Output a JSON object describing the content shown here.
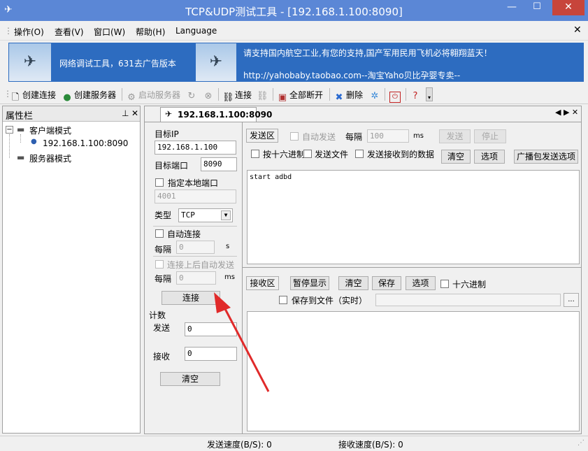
{
  "window": {
    "title": "TCP&UDP测试工具 - [192.168.1.100:8090]",
    "minimize": "—",
    "maximize": "☐",
    "close": "✕",
    "app_icon": "tool-icon"
  },
  "menu": {
    "items": [
      "操作(O)",
      "查看(V)",
      "窗口(W)",
      "帮助(H)",
      "Language"
    ],
    "close": "✕"
  },
  "banner": {
    "left_text": "网络调试工具，631去广告版本",
    "right_line1": "请支持国内航空工业,有您的支持,国产军用民用飞机必将翱翔蓝天！",
    "right_line2": "http://yahobaby.taobao.com--淘宝Yaho贝比孕婴专卖--"
  },
  "toolbar": {
    "create_conn": "创建连接",
    "create_server": "创建服务器",
    "start_server": "启动服务器",
    "connect": "连接",
    "disconnect_all": "全部断开",
    "delete": "删除"
  },
  "left": {
    "title": "属性栏",
    "pin": "ᚘ",
    "close": "✕",
    "tree_client": "客户端模式",
    "tree_conn": "192.168.1.100:8090",
    "tree_server": "服务器模式",
    "expand": "−"
  },
  "tab": {
    "label": "192.168.1.100:8090",
    "nav": "◀ ▶ ✕"
  },
  "conn": {
    "target_ip_label": "目标IP",
    "target_ip": "192.168.1.100",
    "target_port_label": "目标端口",
    "target_port": "8090",
    "local_port_label": "指定本地端口",
    "local_port": "4001",
    "type_label": "类型",
    "type": "TCP",
    "auto_connect_label": "自动连接",
    "interval_label": "每隔",
    "interval1": "0",
    "unit_s": "s",
    "auto_send_label": "连接上后自动发送",
    "interval2": "0",
    "unit_ms": "ms",
    "connect_btn": "连接"
  },
  "counter": {
    "title": "计数",
    "send_label": "发送",
    "send_value": "0",
    "recv_label": "接收",
    "recv_value": "0",
    "clear_btn": "清空"
  },
  "send": {
    "area_btn": "发送区",
    "auto_send": "自动发送",
    "interval_label": "每隔",
    "interval": "100",
    "unit": "ms",
    "send_btn": "发送",
    "stop_btn": "停止",
    "hex_send": "按十六进制",
    "send_file": "发送文件",
    "send_received": "发送接收到的数据",
    "clear_btn": "清空",
    "options_btn": "选项",
    "broadcast_btn": "广播包发送选项",
    "content": "start adbd"
  },
  "recv": {
    "area_btn": "接收区",
    "pause_btn": "暂停显示",
    "clear_btn": "清空",
    "save_btn": "保存",
    "options_btn": "选项",
    "hex_label": "十六进制",
    "save_file_label": "保存到文件（实时）",
    "browse_btn": "..."
  },
  "status": {
    "send_speed": "发送速度(B/S): 0",
    "recv_speed": "接收速度(B/S): 0"
  },
  "colors": {
    "titlebar": "#5b87d6",
    "banner": "#2d6cc0",
    "arrow": "#e02a2a"
  }
}
